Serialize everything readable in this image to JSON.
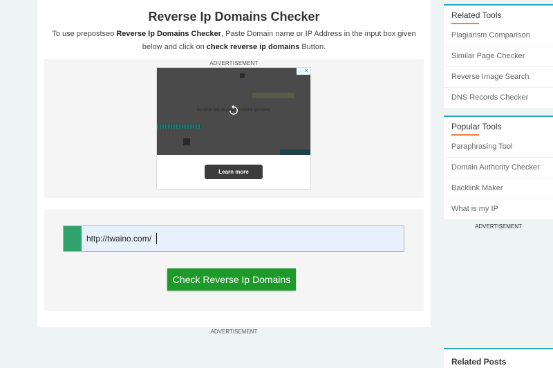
{
  "page": {
    "title": "Reverse Ip Domains Checker",
    "intro": {
      "part1": "To use prepostseo ",
      "tool_name": "Reverse Ip Domains Checker",
      "part2": ", Paste Domain name or IP Address in the input box given below and click on ",
      "button_ref": "check reverse ip domains",
      "part3": " Button."
    }
  },
  "ad": {
    "label": "ADVERTISEMENT",
    "caption": "For all the help we need in a need to give online",
    "learn_more": "Learn more",
    "choices": "ⓘ✕"
  },
  "tool": {
    "url_value": "http://twaino.com/",
    "check_button": "Check Reverse Ip Domains"
  },
  "bottom_ad_label": "ADVERTISEMENT",
  "sidebar": {
    "related_tools": {
      "title": "Related Tools",
      "items": [
        "Plagiarism Comparison",
        "Similar Page Checker",
        "Reverse Image Search",
        "DNS Records Checker"
      ]
    },
    "popular_tools": {
      "title": "Popular Tools",
      "items": [
        "Paraphrasing Tool",
        "Domain Authority Checker",
        "Backlink Maker",
        "What is my IP"
      ]
    },
    "ad_label": "ADVERTISEMENT",
    "related_posts": {
      "title": "Related Posts"
    }
  },
  "colors": {
    "accent_green": "#1d9a29",
    "prefix_green": "#2fa36b",
    "sidebar_border": "#2aa7c9",
    "title_underline": "#f0803c"
  }
}
